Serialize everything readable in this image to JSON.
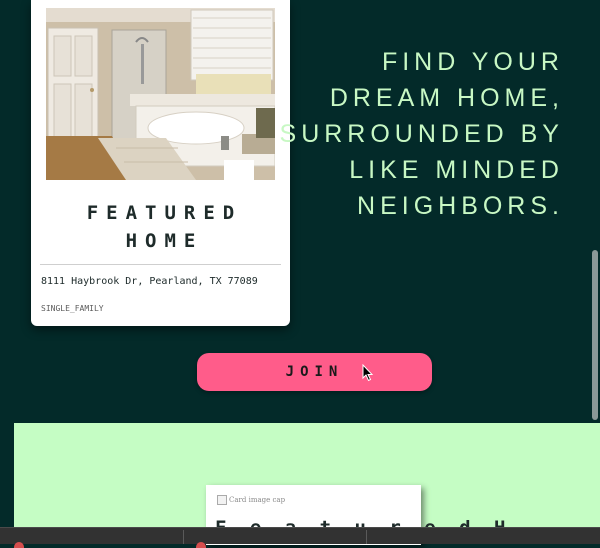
{
  "featured_card": {
    "title": "FEATURED HOME",
    "address": "8111 Haybrook Dr, Pearland, TX 77089",
    "property_type": "SINGLE_FAMILY"
  },
  "hero": {
    "headline": "FIND YOUR DREAM HOME, SURROUNDED BY LIKE MINDED NEIGHBORS."
  },
  "join_button": {
    "label": "JOIN"
  },
  "second_card": {
    "image_alt": "Card image cap",
    "title_partial": "F e a t u r e d  H"
  },
  "colors": {
    "background": "#032a29",
    "accent_green": "#c8f8c4",
    "button_pink": "#ff5c8a",
    "section_green": "#c5fdc4"
  }
}
